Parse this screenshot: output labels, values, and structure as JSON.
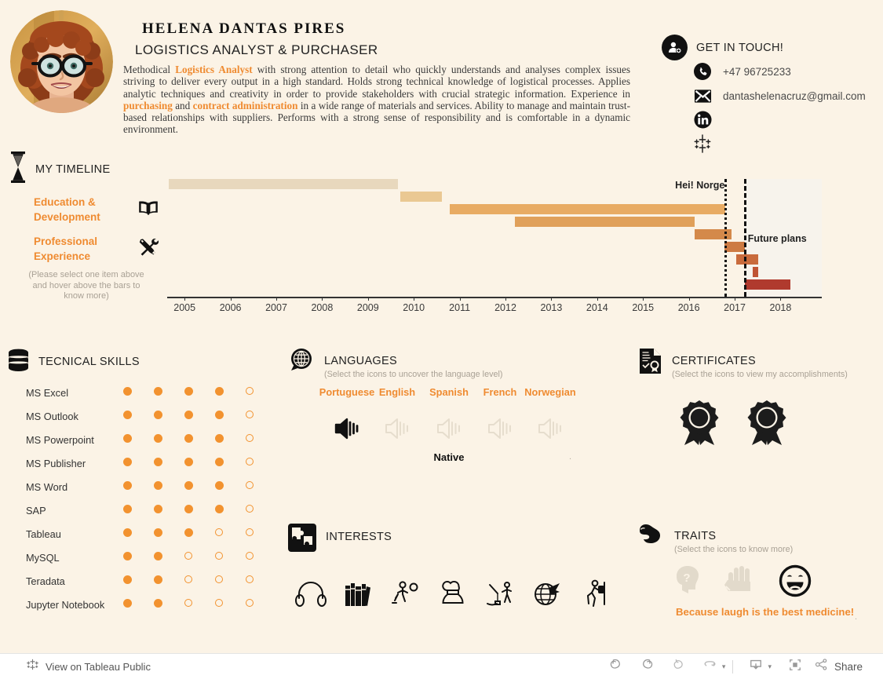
{
  "header": {
    "name": "HELENA DANTAS PIRES",
    "job_title": "LOGISTICS ANALYST & PURCHASER",
    "summary_parts": [
      {
        "t": "Methodical ",
        "hl": false
      },
      {
        "t": "Logistics Analyst",
        "hl": true
      },
      {
        "t": " with strong attention to detail who quickly understands and analyses complex issues striving to deliver every output in a high standard. Holds strong technical knowledge of logistical processes. Applies analytic techniques and creativity in order to provide stakeholders with crucial strategic information. Experience in ",
        "hl": false
      },
      {
        "t": "purchasing",
        "hl": true
      },
      {
        "t": " and ",
        "hl": false
      },
      {
        "t": "contract administration",
        "hl": true
      },
      {
        "t": " in a wide range of materials and services. Ability to manage and maintain trust-based relationships with suppliers. Performs with a strong sense of responsibility and is comfortable in a dynamic environment.",
        "hl": false
      }
    ],
    "photo_alt": "profile-photo"
  },
  "contact": {
    "title": "GET IN TOUCH!",
    "phone": "+47 96725233",
    "email": "dantashelenacruz@gmail.com",
    "icons": [
      "user-plus-icon",
      "phone-icon",
      "envelope-icon",
      "linkedin-icon",
      "tableau-icon"
    ]
  },
  "timeline": {
    "title": "MY TIMELINE",
    "icon": "hourglass-icon",
    "options": [
      {
        "label": "Education & Development",
        "icon": "book-icon"
      },
      {
        "label": "Professional Experience",
        "icon": "tools-icon"
      }
    ],
    "note": "(Please select one item above and hover above the bars to know more)",
    "annotations": [
      {
        "text": "Hei! Norge",
        "x": 2016.78
      },
      {
        "text": "Future plans",
        "x": 2017.2
      }
    ]
  },
  "chart_data": {
    "type": "bar",
    "orientation": "horizontal-gantt",
    "title": "My Timeline",
    "xlabel": "",
    "ylabel": "",
    "xlim": [
      2004.62,
      2018.9
    ],
    "grid": false,
    "legend": "none",
    "tick_labels": [
      "2005",
      "2006",
      "2007",
      "2008",
      "2009",
      "2010",
      "2011",
      "2012",
      "2013",
      "2014",
      "2015",
      "2016",
      "2017",
      "2018"
    ],
    "ticks": [
      2005,
      2006,
      2007,
      2008,
      2009,
      2010,
      2011,
      2012,
      2013,
      2014,
      2015,
      2016,
      2017,
      2018
    ],
    "future_region": {
      "start": 2017.2,
      "end": 2019.4,
      "color": "#f7f3ec"
    },
    "reference_lines": [
      {
        "label": "Hei! Norge",
        "x": 2016.78,
        "style": "dotted"
      },
      {
        "label": "Future plans",
        "x": 2017.2,
        "style": "dashed"
      }
    ],
    "bars": [
      {
        "row": 0,
        "start": 2004.65,
        "end": 2009.66,
        "color": "#e8d8bd"
      },
      {
        "row": 1,
        "start": 2009.7,
        "end": 2010.62,
        "color": "#eac893"
      },
      {
        "row": 2,
        "start": 2010.78,
        "end": 2016.8,
        "color": "#e8ab63"
      },
      {
        "row": 3,
        "start": 2012.2,
        "end": 2016.13,
        "color": "#e0a05a"
      },
      {
        "row": 4,
        "start": 2016.13,
        "end": 2016.93,
        "color": "#d4894a"
      },
      {
        "row": 5,
        "start": 2016.78,
        "end": 2017.22,
        "color": "#cd7b43"
      },
      {
        "row": 6,
        "start": 2017.03,
        "end": 2017.52,
        "color": "#c96b3c"
      },
      {
        "row": 7,
        "start": 2017.4,
        "end": 2017.52,
        "color": "#bf5434"
      },
      {
        "row": 8,
        "start": 2017.22,
        "end": 2018.22,
        "color": "#b03a2e"
      }
    ]
  },
  "skills": {
    "title": "TECNICAL SKILLS",
    "icon": "database-icon",
    "max_level": 5,
    "items": [
      {
        "name": "MS Excel",
        "level": 4
      },
      {
        "name": "MS Outlook",
        "level": 4
      },
      {
        "name": "MS Powerpoint",
        "level": 4
      },
      {
        "name": "MS Publisher",
        "level": 4
      },
      {
        "name": "MS Word",
        "level": 4
      },
      {
        "name": "SAP",
        "level": 4
      },
      {
        "name": "Tableau",
        "level": 3
      },
      {
        "name": "MySQL",
        "level": 2
      },
      {
        "name": "Teradata",
        "level": 2
      },
      {
        "name": "Jupyter Notebook",
        "level": 2
      }
    ]
  },
  "languages": {
    "title": "LANGUAGES",
    "subtitle": "(Select the icons to uncover the language level)",
    "icon": "globe-search-icon",
    "items": [
      {
        "name": "Portuguese",
        "selected": true,
        "level": "Native"
      },
      {
        "name": "English",
        "selected": false,
        "level": ""
      },
      {
        "name": "Spanish",
        "selected": false,
        "level": ""
      },
      {
        "name": "French",
        "selected": false,
        "level": ""
      },
      {
        "name": "Norwegian",
        "selected": false,
        "level": ""
      }
    ],
    "selected_level": "Native"
  },
  "certificates": {
    "title": "CERTIFICATES",
    "subtitle": "(Select the icons to view my accomplishments)",
    "icon": "certificate-doc-icon",
    "items": [
      {
        "icon": "award-ribbon-icon"
      },
      {
        "icon": "award-ribbon-icon"
      }
    ]
  },
  "interests": {
    "title": "INTERESTS",
    "icon": "puzzle-icon",
    "items": [
      {
        "icon": "headphones-icon"
      },
      {
        "icon": "books-icon"
      },
      {
        "icon": "ball-player-icon"
      },
      {
        "icon": "chef-hat-icon"
      },
      {
        "icon": "fishing-icon"
      },
      {
        "icon": "globe-travel-icon"
      },
      {
        "icon": "hiking-icon"
      }
    ]
  },
  "traits": {
    "title": "TRAITS",
    "subtitle": "(Select the icons to know more)",
    "icon": "muscle-arm-icon",
    "items": [
      {
        "icon": "thinking-head-icon",
        "selected": false
      },
      {
        "icon": "hands-icon",
        "selected": false
      },
      {
        "icon": "laughing-face-icon",
        "selected": true
      }
    ],
    "caption": "Because laugh is the best medicine!"
  },
  "footer": {
    "view_label": "View on Tableau Public",
    "tableau_icon": "tableau-icon",
    "buttons": [
      {
        "name": "undo",
        "icon": "undo-icon"
      },
      {
        "name": "redo",
        "icon": "redo-icon"
      },
      {
        "name": "revert",
        "icon": "revert-icon"
      },
      {
        "name": "refresh",
        "icon": "refresh-icon"
      }
    ],
    "share_label": "Share",
    "download_icon": "download-icon",
    "fullscreen_icon": "fullscreen-icon",
    "share_icon": "share-icon"
  },
  "colors": {
    "background": "#fbf3e6",
    "accent": "#ef8b31",
    "dot": "#f2922f",
    "muted": "#a9a195"
  }
}
